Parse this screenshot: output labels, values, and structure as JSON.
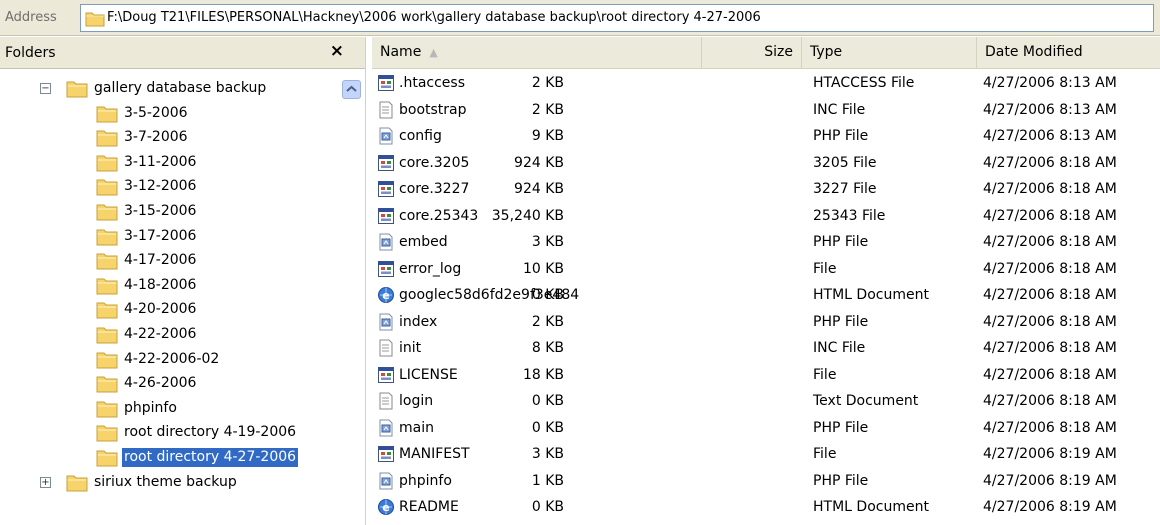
{
  "address": {
    "label": "Address",
    "path": "F:\\Doug T21\\FILES\\PERSONAL\\Hackney\\2006 work\\gallery database backup\\root directory 4-27-2006"
  },
  "folders_pane": {
    "title": "Folders",
    "close": "×",
    "tree": [
      {
        "label": "gallery database backup",
        "level": 0,
        "expander": "−",
        "selected": false
      },
      {
        "label": "3-5-2006",
        "level": 1,
        "selected": false
      },
      {
        "label": "3-7-2006",
        "level": 1,
        "selected": false
      },
      {
        "label": "3-11-2006",
        "level": 1,
        "selected": false
      },
      {
        "label": "3-12-2006",
        "level": 1,
        "selected": false
      },
      {
        "label": "3-15-2006",
        "level": 1,
        "selected": false
      },
      {
        "label": "3-17-2006",
        "level": 1,
        "selected": false
      },
      {
        "label": "4-17-2006",
        "level": 1,
        "selected": false
      },
      {
        "label": "4-18-2006",
        "level": 1,
        "selected": false
      },
      {
        "label": "4-20-2006",
        "level": 1,
        "selected": false
      },
      {
        "label": "4-22-2006",
        "level": 1,
        "selected": false
      },
      {
        "label": "4-22-2006-02",
        "level": 1,
        "selected": false
      },
      {
        "label": "4-26-2006",
        "level": 1,
        "selected": false
      },
      {
        "label": "phpinfo",
        "level": 1,
        "selected": false
      },
      {
        "label": "root directory 4-19-2006",
        "level": 1,
        "selected": false
      },
      {
        "label": "root directory 4-27-2006",
        "level": 1,
        "selected": true
      },
      {
        "label": "siriux theme backup",
        "level": 0,
        "expander": "+",
        "selected": false
      }
    ]
  },
  "list": {
    "columns": {
      "name": "Name",
      "size": "Size",
      "type": "Type",
      "date": "Date Modified"
    },
    "files": [
      {
        "name": ".htaccess",
        "size": "2 KB",
        "type": "HTACCESS File",
        "date": "4/27/2006 8:13 AM",
        "icon": "generic-file-icon"
      },
      {
        "name": "bootstrap",
        "size": "2 KB",
        "type": "INC File",
        "date": "4/27/2006 8:13 AM",
        "icon": "text-file-icon"
      },
      {
        "name": "config",
        "size": "9 KB",
        "type": "PHP File",
        "date": "4/27/2006 8:13 AM",
        "icon": "php-file-icon"
      },
      {
        "name": "core.3205",
        "size": "924 KB",
        "type": "3205 File",
        "date": "4/27/2006 8:18 AM",
        "icon": "generic-file-icon"
      },
      {
        "name": "core.3227",
        "size": "924 KB",
        "type": "3227 File",
        "date": "4/27/2006 8:18 AM",
        "icon": "generic-file-icon"
      },
      {
        "name": "core.25343",
        "size": "35,240 KB",
        "type": "25343 File",
        "date": "4/27/2006 8:18 AM",
        "icon": "generic-file-icon"
      },
      {
        "name": "embed",
        "size": "3 KB",
        "type": "PHP File",
        "date": "4/27/2006 8:18 AM",
        "icon": "php-file-icon"
      },
      {
        "name": "error_log",
        "size": "10 KB",
        "type": "File",
        "date": "4/27/2006 8:18 AM",
        "icon": "generic-file-icon"
      },
      {
        "name": "googlec58d6fd2e9f3e484",
        "size": "0 KB",
        "type": "HTML Document",
        "date": "4/27/2006 8:18 AM",
        "icon": "html-document-icon"
      },
      {
        "name": "index",
        "size": "2 KB",
        "type": "PHP File",
        "date": "4/27/2006 8:18 AM",
        "icon": "php-file-icon"
      },
      {
        "name": "init",
        "size": "8 KB",
        "type": "INC File",
        "date": "4/27/2006 8:18 AM",
        "icon": "text-file-icon"
      },
      {
        "name": "LICENSE",
        "size": "18 KB",
        "type": "File",
        "date": "4/27/2006 8:18 AM",
        "icon": "generic-file-icon"
      },
      {
        "name": "login",
        "size": "0 KB",
        "type": "Text Document",
        "date": "4/27/2006 8:18 AM",
        "icon": "text-file-icon"
      },
      {
        "name": "main",
        "size": "0 KB",
        "type": "PHP File",
        "date": "4/27/2006 8:18 AM",
        "icon": "php-file-icon"
      },
      {
        "name": "MANIFEST",
        "size": "3 KB",
        "type": "File",
        "date": "4/27/2006 8:19 AM",
        "icon": "generic-file-icon"
      },
      {
        "name": "phpinfo",
        "size": "1 KB",
        "type": "PHP File",
        "date": "4/27/2006 8:19 AM",
        "icon": "php-file-icon"
      },
      {
        "name": "README",
        "size": "0 KB",
        "type": "HTML Document",
        "date": "4/27/2006 8:19 AM",
        "icon": "html-document-icon"
      }
    ]
  },
  "colors": {
    "selection": "#316ac5",
    "folder": "#f6d36b",
    "chrome": "#ece9d8"
  }
}
